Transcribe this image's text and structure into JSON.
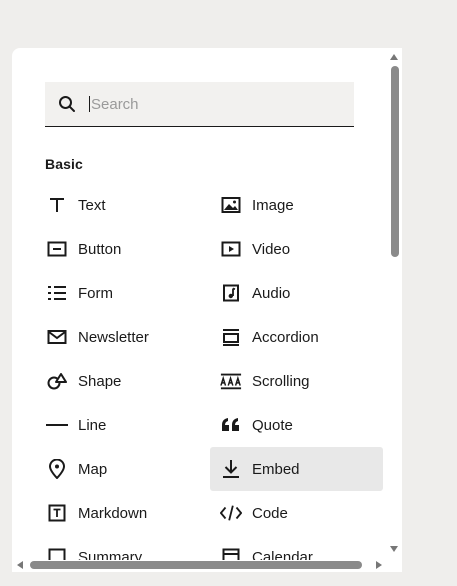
{
  "search": {
    "placeholder": "Search"
  },
  "section": {
    "title": "Basic"
  },
  "items": [
    {
      "label": "Text",
      "icon": "text-icon"
    },
    {
      "label": "Image",
      "icon": "image-icon"
    },
    {
      "label": "Button",
      "icon": "button-icon"
    },
    {
      "label": "Video",
      "icon": "video-icon"
    },
    {
      "label": "Form",
      "icon": "form-icon"
    },
    {
      "label": "Audio",
      "icon": "audio-icon"
    },
    {
      "label": "Newsletter",
      "icon": "newsletter-icon"
    },
    {
      "label": "Accordion",
      "icon": "accordion-icon"
    },
    {
      "label": "Shape",
      "icon": "shape-icon"
    },
    {
      "label": "Scrolling",
      "icon": "scrolling-icon"
    },
    {
      "label": "Line",
      "icon": "line-icon"
    },
    {
      "label": "Quote",
      "icon": "quote-icon"
    },
    {
      "label": "Map",
      "icon": "map-pin-icon"
    },
    {
      "label": "Embed",
      "icon": "embed-icon",
      "highlighted": true
    },
    {
      "label": "Markdown",
      "icon": "markdown-icon"
    },
    {
      "label": "Code",
      "icon": "code-icon"
    },
    {
      "label": "Summary",
      "icon": "summary-icon"
    },
    {
      "label": "Calendar",
      "icon": "calendar-icon"
    }
  ],
  "colors": {
    "panel": "#ffffff",
    "background": "#efeeec",
    "search_bg": "#f2f1ef",
    "highlight": "#e8e8e8",
    "text": "#1a1a1a"
  }
}
